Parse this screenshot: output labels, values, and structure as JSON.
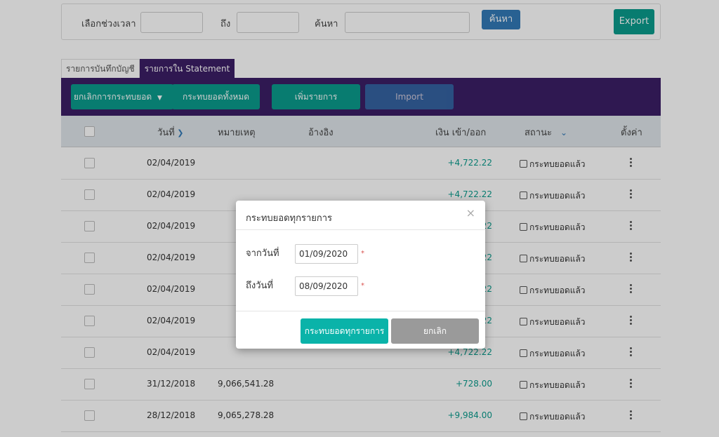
{
  "filter": {
    "period_label": "เลือกช่วงเวลา",
    "to_label": "ถึง",
    "search_label": "ค้นหา",
    "search_button": "ค้นหา",
    "export_button": "Export"
  },
  "tabs": [
    {
      "label": "รายการบันทึกบัญชี"
    },
    {
      "label": "รายการใน Statement"
    }
  ],
  "toolbar": {
    "cancel_offset": "ยกเลิกการกระทบยอด",
    "offset_all": "กระทบยอดทั้งหมด",
    "add_item": "เพิ่มรายการ",
    "import": "Import"
  },
  "table": {
    "columns": {
      "date": "วันที่",
      "note": "หมายเหตุ",
      "reference": "อ้างอิง",
      "amount": "เงิน เข้า/ออก",
      "status": "สถานะ",
      "settings": "ตั้งค่า"
    },
    "rows": [
      {
        "date": "02/04/2019",
        "note": "",
        "amount": "+4,722.22",
        "status": "กระทบยอดแล้ว"
      },
      {
        "date": "02/04/2019",
        "note": "",
        "amount": "+4,722.22",
        "status": "กระทบยอดแล้ว"
      },
      {
        "date": "02/04/2019",
        "note": "",
        "amount": "+4,722.22",
        "status": "กระทบยอดแล้ว"
      },
      {
        "date": "02/04/2019",
        "note": "",
        "amount": "+4,722.22",
        "status": "กระทบยอดแล้ว"
      },
      {
        "date": "02/04/2019",
        "note": "",
        "amount": "+4,722.22",
        "status": "กระทบยอดแล้ว"
      },
      {
        "date": "02/04/2019",
        "note": "",
        "amount": "+4,722.22",
        "status": "กระทบยอดแล้ว"
      },
      {
        "date": "02/04/2019",
        "note": "",
        "amount": "+4,722.22",
        "status": "กระทบยอดแล้ว"
      },
      {
        "date": "31/12/2018",
        "note": "9,066,541.28",
        "amount": "+728.00",
        "status": "กระทบยอดแล้ว"
      },
      {
        "date": "28/12/2018",
        "note": "9,065,278.28",
        "amount": "+9,984.00",
        "status": "กระทบยอดแล้ว"
      }
    ]
  },
  "modal": {
    "title": "กระทบยอดทุกรายการ",
    "from_label": "จากวันที่",
    "from_value": "01/09/2020",
    "to_label": "ถึงวันที่",
    "to_value": "08/09/2020",
    "required_mark": "*",
    "confirm_button": "กระทบยอดทุกรายการ",
    "cancel_button": "ยกเลิก",
    "close_glyph": "×"
  },
  "colors": {
    "toolbar": "#3b1f66",
    "teal": "#0a9b8c",
    "blue": "#337ab7",
    "amount": "#0a9b8c"
  }
}
